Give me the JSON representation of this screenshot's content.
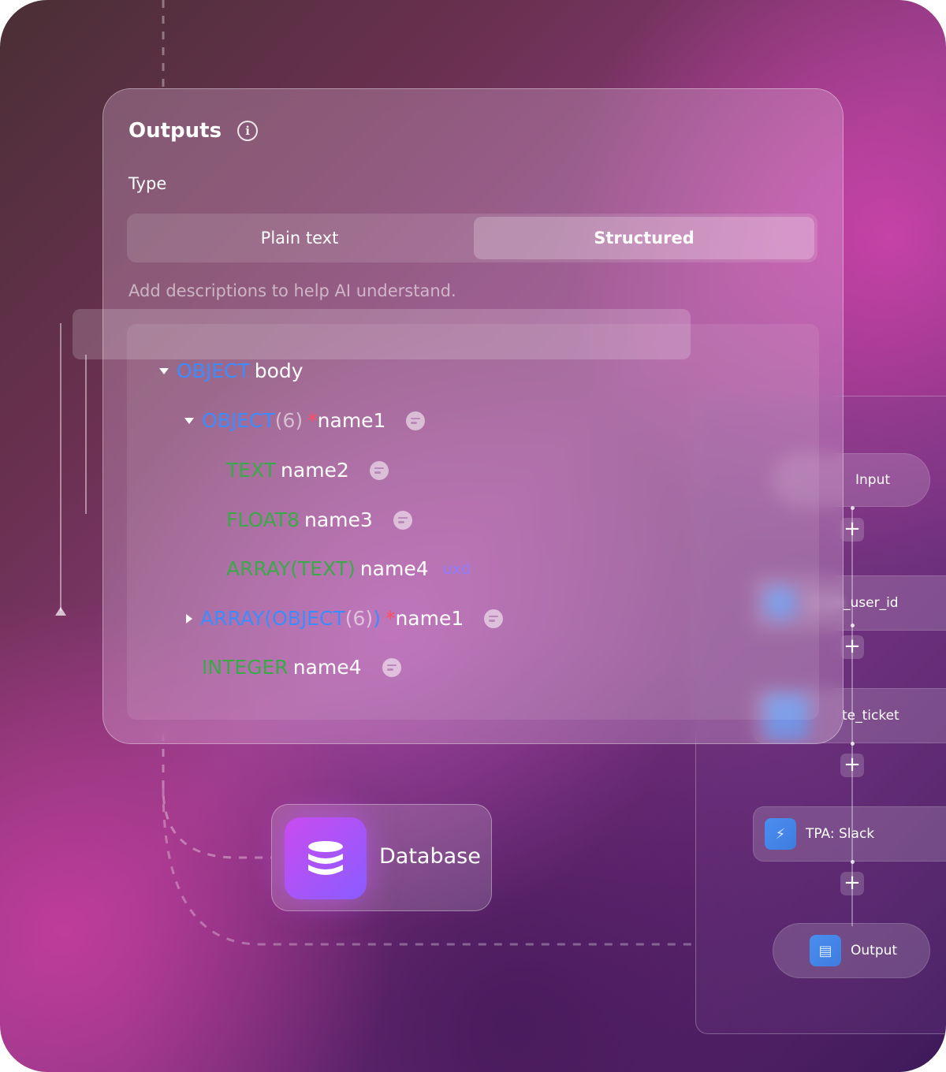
{
  "outputs": {
    "title": "Outputs",
    "type_label": "Type",
    "type_options": [
      "Plain text",
      "Structured"
    ],
    "selected_type": "Structured",
    "hint": "Add descriptions to help AI understand."
  },
  "schema": {
    "rows": [
      {
        "type": "OBJECT",
        "name": "body"
      },
      {
        "type": "OBJECT",
        "count": "(6)",
        "required": "*",
        "name": "name1"
      },
      {
        "type": "TEXT",
        "name": "name2"
      },
      {
        "type": "FLOAT8",
        "name": "name3"
      },
      {
        "type": "ARRAY(TEXT)",
        "name": "name4",
        "description": "uxd"
      },
      {
        "type_prefix": "ARRAY(OBJECT",
        "count": "(6)",
        "type_suffix": ")",
        "required": "*",
        "name": "name1"
      },
      {
        "type": "INTEGER",
        "name": "name4"
      }
    ]
  },
  "database_node": {
    "label": "Database",
    "icon": "database-icon"
  },
  "flow": {
    "nodes": [
      {
        "label": "Input"
      },
      {
        "label": "_user_id"
      },
      {
        "label": "te_ticket"
      },
      {
        "label": "TPA: Slack"
      },
      {
        "label": "Output"
      }
    ],
    "add_label": "+"
  },
  "colors": {
    "type_object": "#3d8cff",
    "type_primitive": "#3ba84a",
    "required": "#ff4d5e",
    "description": "#8c7cff"
  }
}
